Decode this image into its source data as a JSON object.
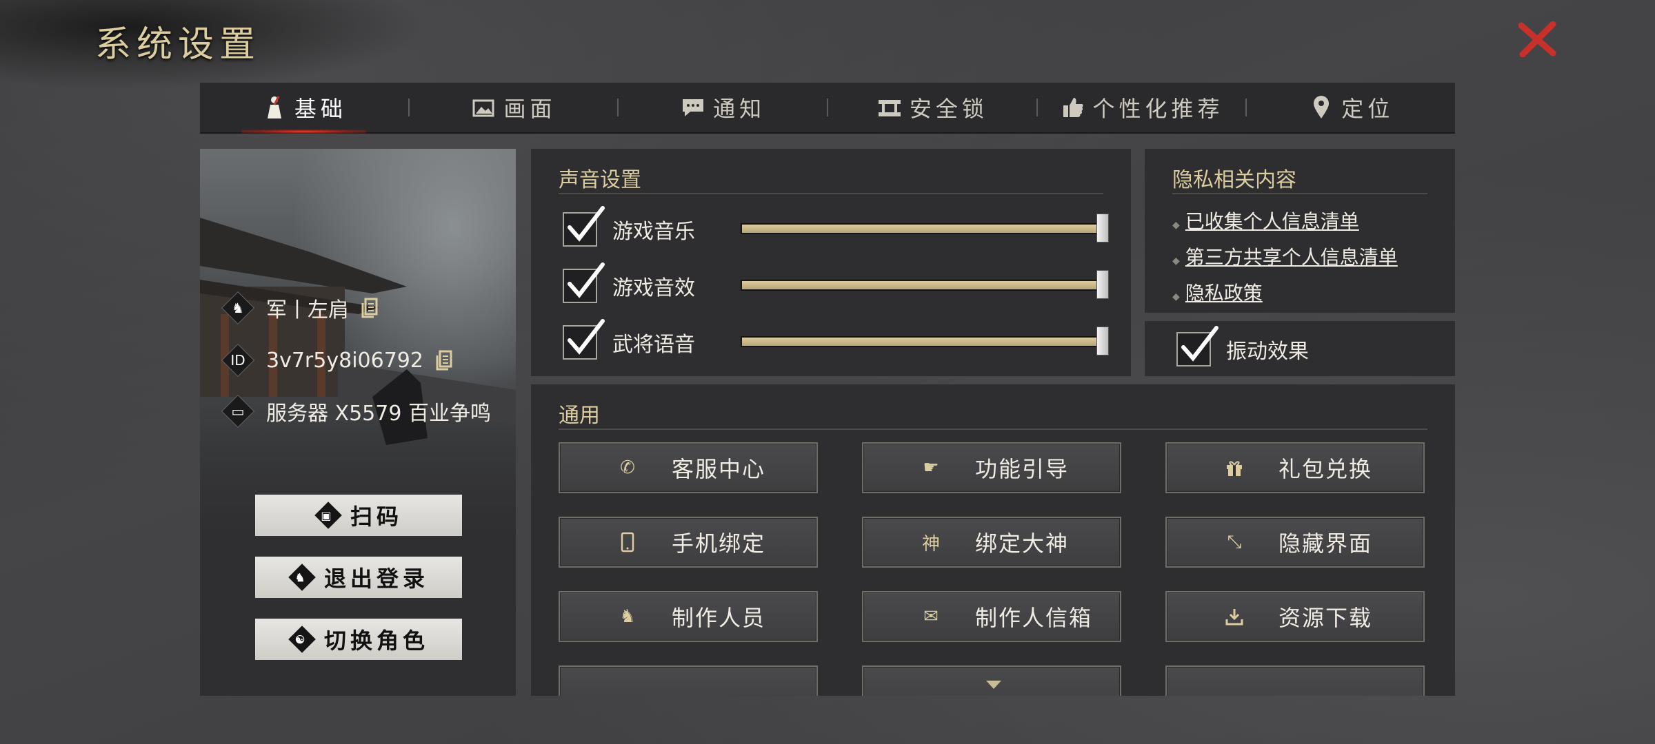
{
  "window": {
    "title": "系统设置"
  },
  "tabs": [
    {
      "label": "基础",
      "icon": "figure-icon",
      "active": true
    },
    {
      "label": "画面",
      "icon": "image-icon",
      "active": false
    },
    {
      "label": "通知",
      "icon": "chat-icon",
      "active": false
    },
    {
      "label": "安全锁",
      "icon": "lock-icon",
      "active": false
    },
    {
      "label": "个性化推荐",
      "icon": "thumbs-up-icon",
      "active": false
    },
    {
      "label": "定位",
      "icon": "location-pin-icon",
      "active": false
    }
  ],
  "profile": {
    "name": "军丨左肩",
    "id_label": "ID",
    "id": "3v7r5y8i06792",
    "server": "服务器 X5579 百业争鸣",
    "buttons": {
      "scan": "扫码",
      "logout": "退出登录",
      "switch_role": "切换角色"
    }
  },
  "sound": {
    "title": "声音设置",
    "items": [
      {
        "label": "游戏音乐",
        "checked": true,
        "level": 1.0
      },
      {
        "label": "游戏音效",
        "checked": true,
        "level": 1.0
      },
      {
        "label": "武将语音",
        "checked": true,
        "level": 1.0
      }
    ]
  },
  "privacy": {
    "title": "隐私相关内容",
    "links": [
      "已收集个人信息清单",
      "第三方共享个人信息清单",
      "隐私政策"
    ]
  },
  "vibration": {
    "label": "振动效果",
    "checked": true
  },
  "general": {
    "title": "通用",
    "buttons": [
      {
        "label": "客服中心",
        "icon": "phone-icon"
      },
      {
        "label": "功能引导",
        "icon": "pointing-hand-icon"
      },
      {
        "label": "礼包兑换",
        "icon": "gift-icon"
      },
      {
        "label": "手机绑定",
        "icon": "mobile-icon"
      },
      {
        "label": "绑定大神",
        "icon": "shen-character-icon",
        "glyph": "神"
      },
      {
        "label": "隐藏界面",
        "icon": "expand-arrows-icon"
      },
      {
        "label": "制作人员",
        "icon": "horse-icon"
      },
      {
        "label": "制作人信箱",
        "icon": "envelope-icon"
      },
      {
        "label": "资源下载",
        "icon": "download-icon"
      }
    ]
  },
  "colors": {
    "accent_gold": "#dccda1",
    "close_red": "#c8312a",
    "tab_active_glow": "#ff3a22"
  }
}
